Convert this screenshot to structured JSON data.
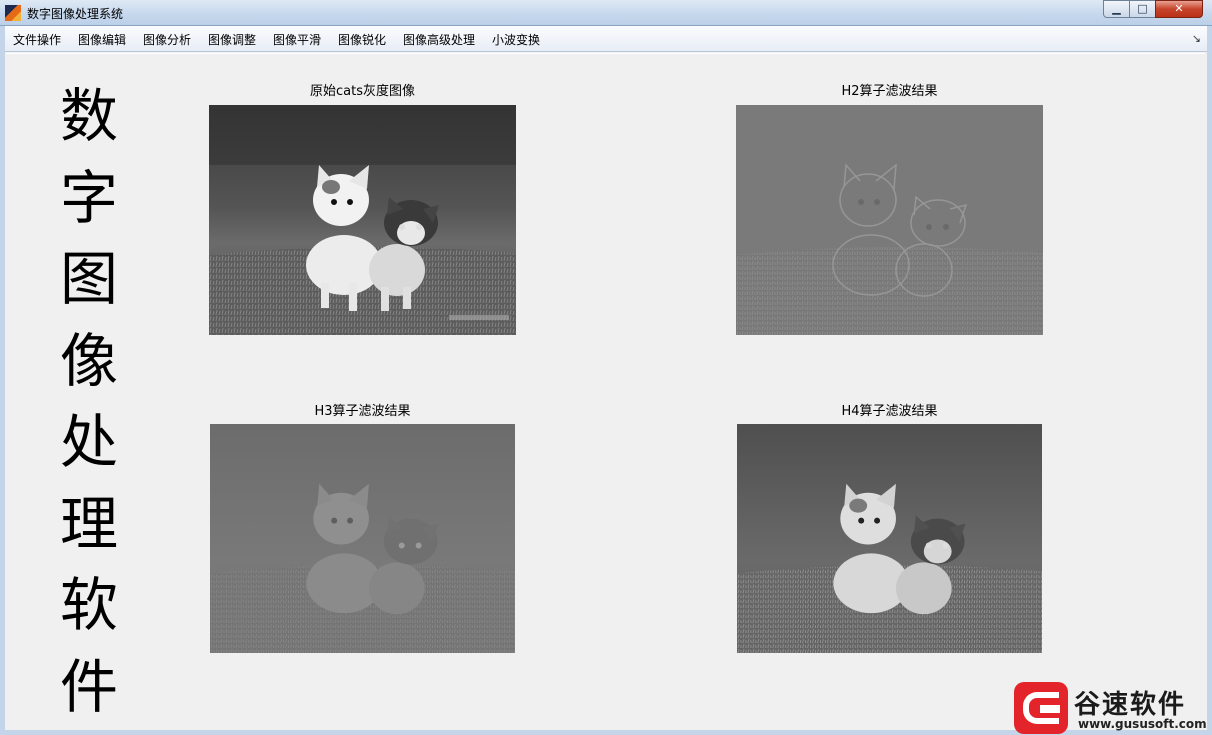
{
  "window": {
    "title": "数字图像处理系统",
    "min_label": "▁",
    "max_label": "□",
    "close_label": "✕"
  },
  "menu": [
    {
      "label": "文件操作"
    },
    {
      "label": "图像编辑"
    },
    {
      "label": "图像分析"
    },
    {
      "label": "图像调整"
    },
    {
      "label": "图像平滑"
    },
    {
      "label": "图像锐化"
    },
    {
      "label": "图像高级处理"
    },
    {
      "label": "小波变换"
    }
  ],
  "menu_overflow_icon": "↘",
  "side_title": [
    "数",
    "字",
    "图",
    "像",
    "处",
    "理",
    "软",
    "件"
  ],
  "panels": [
    {
      "title": "原始cats灰度图像"
    },
    {
      "title": "H2算子滤波结果"
    },
    {
      "title": "H3算子滤波结果"
    },
    {
      "title": "H4算子滤波结果"
    }
  ],
  "watermark": {
    "brand": "谷速软件",
    "url": "www.gususoft.com"
  }
}
